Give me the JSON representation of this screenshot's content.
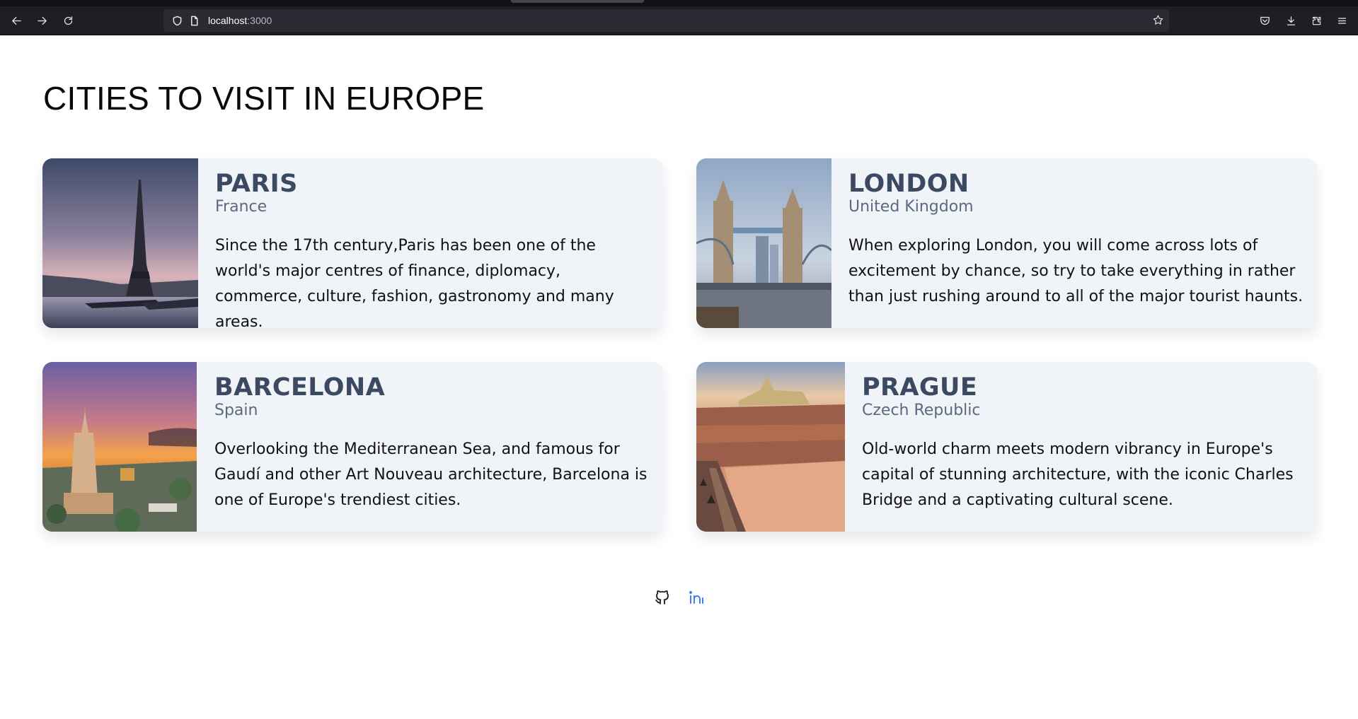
{
  "browser": {
    "url_host": "localhost",
    "url_port": ":3000"
  },
  "page": {
    "title": "CITIES TO VISIT IN EUROPE"
  },
  "cities": [
    {
      "name": "PARIS",
      "country": "France",
      "description": "Since the 17th century,Paris has been one of the world's major centres of finance, diplomacy, commerce, culture, fashion, gastronomy and many areas."
    },
    {
      "name": "LONDON",
      "country": "United Kingdom",
      "description": "When exploring London, you will come across lots of excitement by chance, so try to take everything in rather than just rushing around to all of the major tourist haunts."
    },
    {
      "name": "BARCELONA",
      "country": "Spain",
      "description": "Overlooking the Mediterranean Sea, and famous for Gaudí and other Art Nouveau architecture, Barcelona is one of Europe's trendiest cities."
    },
    {
      "name": "PRAGUE",
      "country": "Czech Republic",
      "description": "Old-world charm meets modern vibrancy in Europe's capital of stunning architecture, with the iconic Charles Bridge and a captivating cultural scene."
    }
  ],
  "footer": {
    "icons": [
      "github-icon",
      "linkedin-icon"
    ],
    "linkedin_color": "#3b82f6"
  }
}
